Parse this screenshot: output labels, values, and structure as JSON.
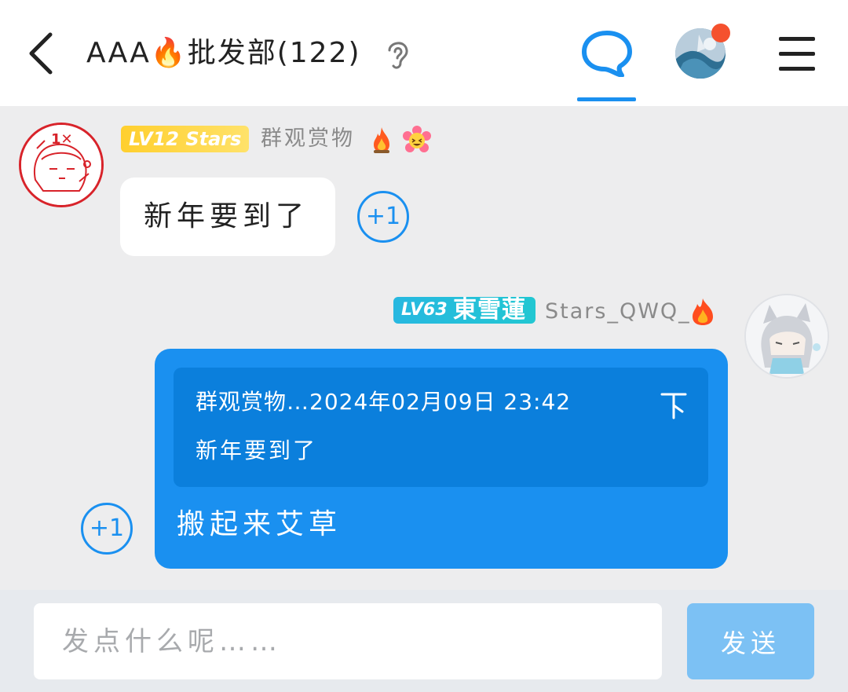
{
  "header": {
    "title": "AAA🔥批发部(122)",
    "back_icon": "chevron-left-icon",
    "listen_icon": "ear-icon",
    "chat_tab_icon": "chat-bubble-icon",
    "menu_icon": "hamburger-menu-icon"
  },
  "messages": [
    {
      "side": "left",
      "level_badge": "LV12 Stars",
      "sender": "群观赏物",
      "text": "新年要到了",
      "plus_one": "+1"
    },
    {
      "side": "right",
      "level_badge_lv": "LV63",
      "level_badge_name": "東雪蓮",
      "sender": "Stars_QWQ_",
      "quote": {
        "meta": "群观赏物…2024年02月09日 23:42",
        "text": "新年要到了"
      },
      "text": "搬起来艾草",
      "plus_one": "+1"
    }
  ],
  "input": {
    "placeholder": "发点什么呢……",
    "value": ""
  },
  "send_label": "发送",
  "colors": {
    "accent": "#1a90f0",
    "bubble_self": "#1a90f0",
    "quote_bg": "#0b7fdc",
    "badge_lv12": "#ffcf2e",
    "badge_lv63": "#27b8e0",
    "notification": "#f5512e",
    "send_disabled": "#7cc1f4"
  }
}
